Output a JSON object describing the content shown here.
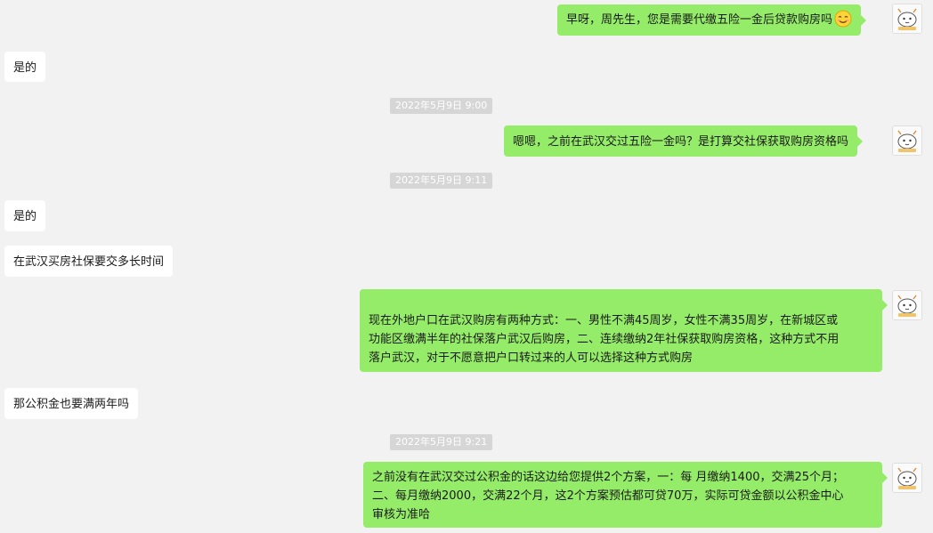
{
  "messages": [
    {
      "side": "right",
      "text": "早呀，周先生，您是需要代缴五险一金后贷款购房吗",
      "emoji": "smiling-face"
    },
    {
      "side": "left",
      "text": "是的"
    },
    {
      "timestamp": "2022年5月9日 9:00"
    },
    {
      "side": "right",
      "text": "嗯嗯，之前在武汉交过五险一金吗？是打算交社保获取购房资格吗"
    },
    {
      "timestamp": "2022年5月9日 9:11"
    },
    {
      "side": "left",
      "text": "是的"
    },
    {
      "side": "left",
      "text": "在武汉买房社保要交多长时间"
    },
    {
      "side": "right",
      "lines": [
        "现在外地户口在武汉购房有两种方式：一、男性不满45周岁，女性不满35周岁，在新城区或",
        "功能区缴满半年的社保落户武汉后购房，二、连续缴纳2年社保获取购房资格，这种方式不用",
        "落户武汉，对于不愿意把户口转过来的人可以选择这种方式购房"
      ]
    },
    {
      "side": "left",
      "text": "那公积金也要满两年吗"
    },
    {
      "timestamp": "2022年5月9日 9:21"
    },
    {
      "side": "right",
      "lines": [
        "之前没有在武汉交过公积金的话这边给您提供2个方案，一：每 月缴纳1400，交满25个月；",
        "二、每月缴纳2000，交满22个月，这2个方案预估都可贷70万，实际可贷金额以公积金中心",
        "审核为准哈"
      ]
    }
  ],
  "colors": {
    "background": "#f2f2f2",
    "sent_bubble": "#95ec69",
    "received_bubble": "#ffffff",
    "timestamp_bg": "#d6d6d6"
  },
  "icons": {
    "avatar": "cartoon-avatar-icon",
    "emoji": "smiling-face-emoji-icon"
  }
}
